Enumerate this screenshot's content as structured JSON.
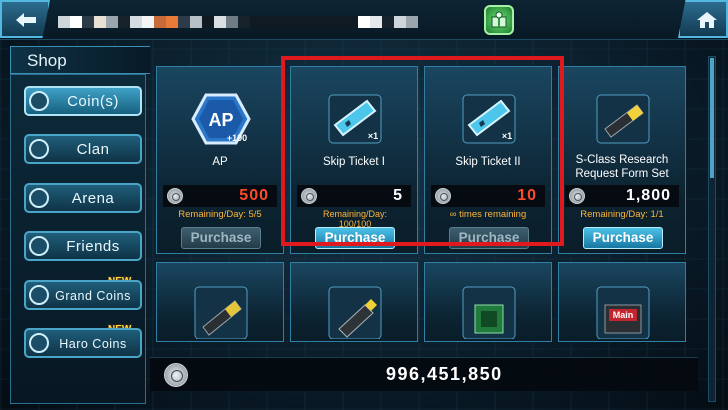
{
  "nav": {
    "back_icon": "back-arrow-icon",
    "home_icon": "home-icon",
    "gift_icon": "gift-icon"
  },
  "shop": {
    "title": "Shop",
    "categories": [
      {
        "label": "Coin(s)",
        "icon": "coin-icon",
        "active": true,
        "new": ""
      },
      {
        "label": "Clan",
        "icon": "clan-icon",
        "active": false,
        "new": ""
      },
      {
        "label": "Arena",
        "icon": "arena-icon",
        "active": false,
        "new": ""
      },
      {
        "label": "Friends",
        "icon": "friends-icon",
        "active": false,
        "new": ""
      },
      {
        "label": "Grand Coins",
        "icon": "grand-coin-icon",
        "active": false,
        "new": "NEW"
      },
      {
        "label": "Haro Coins",
        "icon": "haro-coin-icon",
        "active": false,
        "new": "NEW"
      }
    ]
  },
  "items": [
    {
      "name": "AP",
      "thumb_text": "AP",
      "thumb_badge": "+100",
      "price": "500",
      "price_color": "#ff4a2a",
      "remaining": "Remaining/Day: 5/5",
      "button": "Purchase",
      "enabled": false
    },
    {
      "name": "Skip Ticket I",
      "thumb_badge": "×1",
      "price": "5",
      "price_color": "#ffffff",
      "remaining": "Remaining/Day: 100/100",
      "button": "Purchase",
      "enabled": true
    },
    {
      "name": "Skip Ticket II",
      "thumb_badge": "×1",
      "price": "10",
      "price_color": "#ff4a2a",
      "remaining": "∞ times remaining",
      "button": "Purchase",
      "enabled": false
    },
    {
      "name": "S-Class Research Request Form Set",
      "price": "1,800",
      "price_color": "#ffffff",
      "remaining": "Remaining/Day: 1/1",
      "button": "Purchase",
      "enabled": true
    }
  ],
  "row2_items": [
    {
      "icon": "research-form-icon"
    },
    {
      "icon": "usb-drive-icon"
    },
    {
      "icon": "circuit-chip-icon"
    },
    {
      "icon": "main-module-icon",
      "label": "Main"
    }
  ],
  "balance": {
    "amount": "996,451,850",
    "icon": "coin-icon"
  },
  "colors": {
    "accent": "#4cc2e8",
    "highlight": "#e0191e",
    "price_red": "#ff4a2a",
    "remaining": "#ffb43a"
  }
}
